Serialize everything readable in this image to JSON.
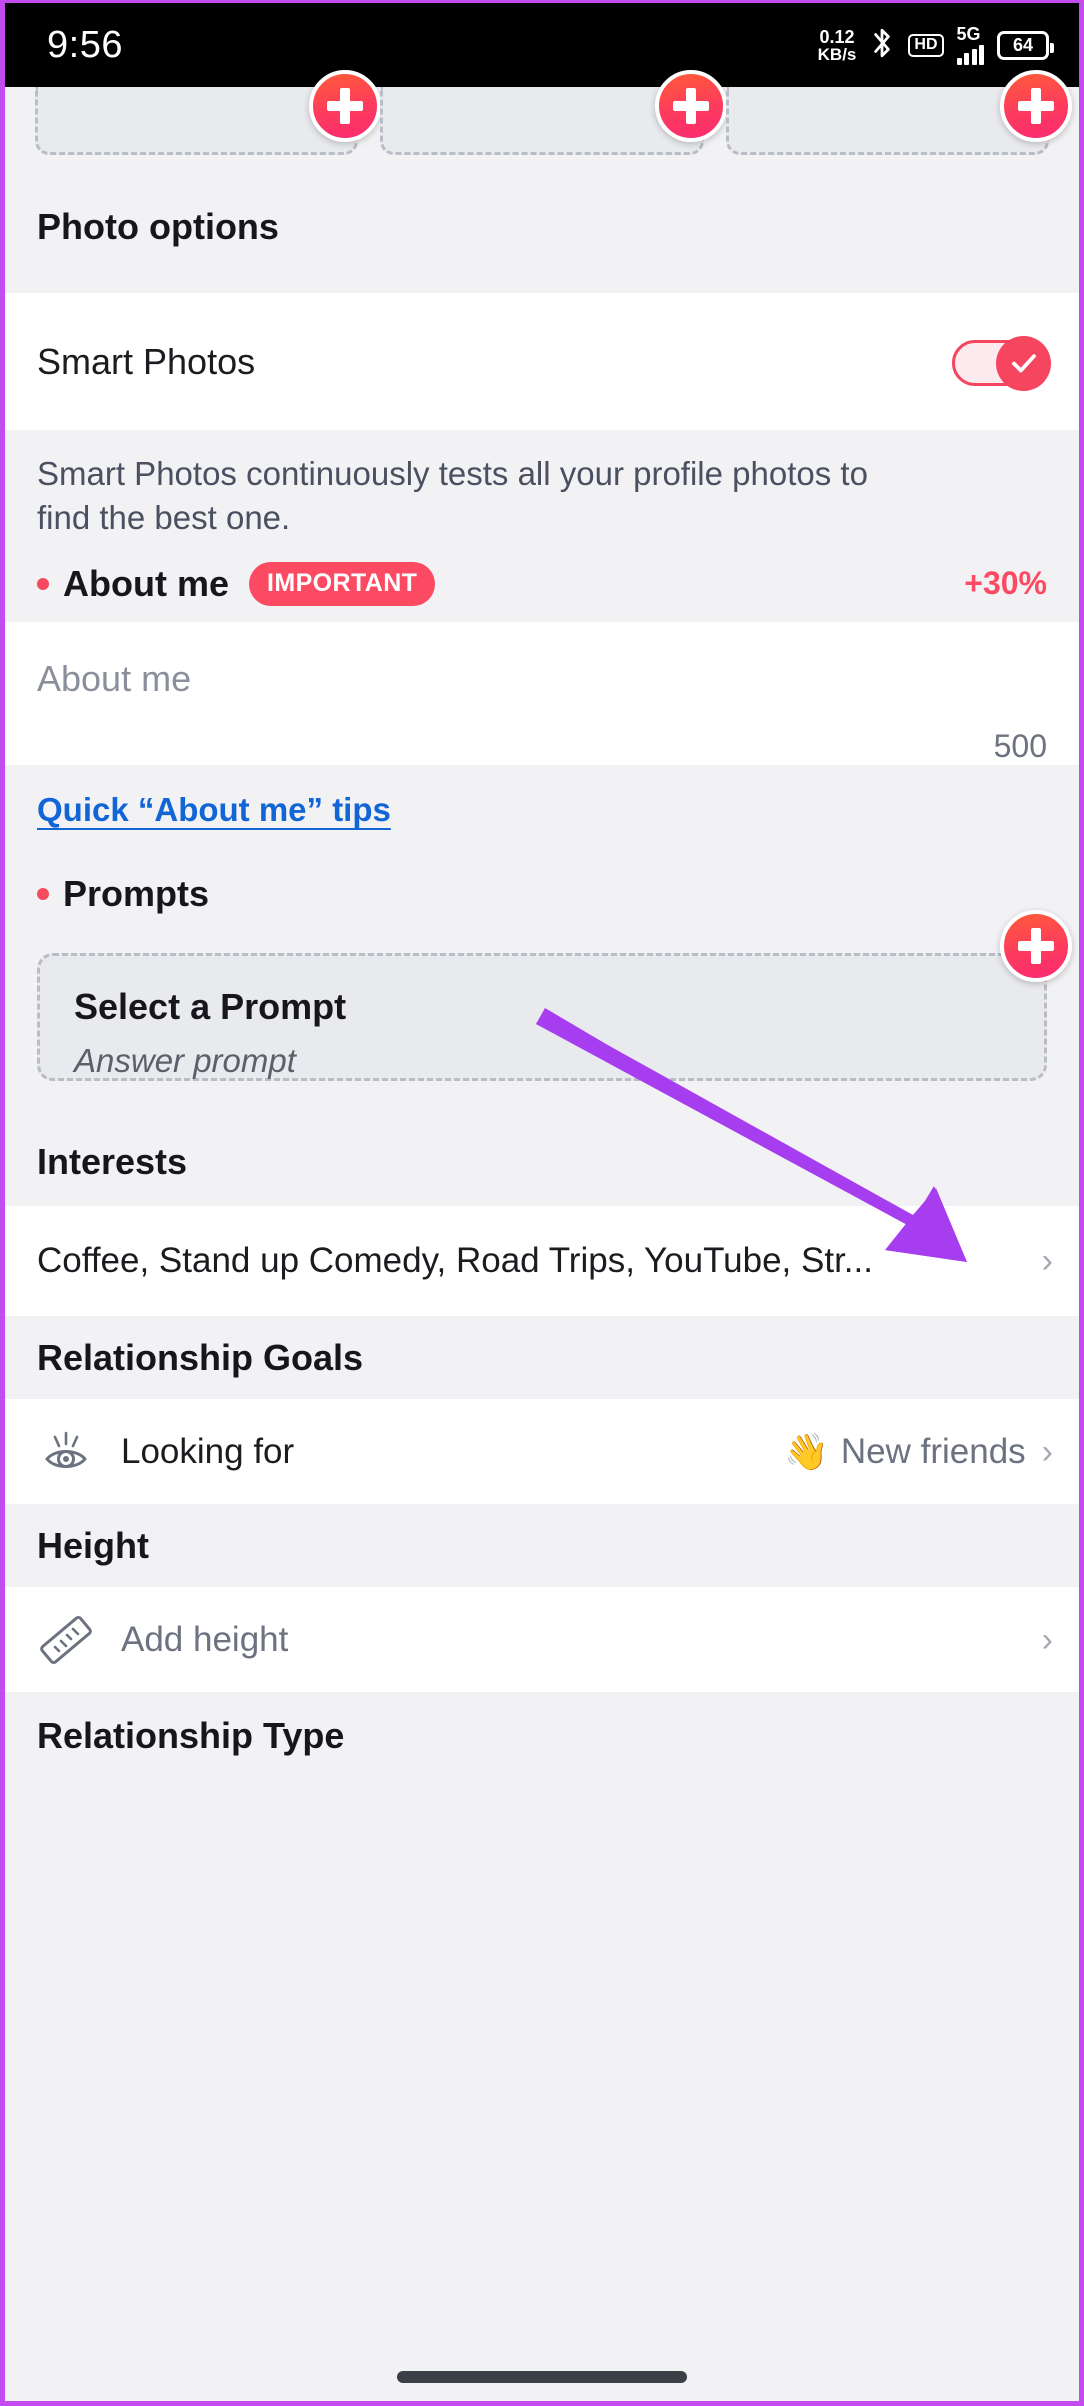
{
  "statusbar": {
    "time": "9:56",
    "net_speed_value": "0.12",
    "net_speed_unit": "KB/s",
    "bluetooth_icon": "bluetooth-icon",
    "hd_label": "HD",
    "network_label": "5G",
    "battery_level": "64"
  },
  "photos": {
    "tiles": [
      {
        "add_label": "+"
      },
      {
        "add_label": "+"
      },
      {
        "add_label": "+"
      }
    ]
  },
  "photo_options": {
    "header": "Photo options",
    "smart_photos_label": "Smart Photos",
    "smart_photos_enabled": "on",
    "description": "Smart Photos continuously tests all your profile photos to find the best one."
  },
  "about_me": {
    "title": "About me",
    "badge": "IMPORTANT",
    "percent": "+30%",
    "placeholder": "About me",
    "counter": "500",
    "tips_link": "Quick “About me” tips"
  },
  "prompts": {
    "title": "Prompts",
    "card_title": "Select a Prompt",
    "card_sub": "Answer prompt",
    "add_label": "+"
  },
  "interests": {
    "header": "Interests",
    "value": "Coffee, Stand up Comedy, Road Trips, YouTube, Str...",
    "chevron": "›"
  },
  "relationship_goals": {
    "header": "Relationship Goals",
    "row_label": "Looking for",
    "row_icon": "eye-icon",
    "value_emoji": "👋",
    "value": "New friends",
    "chevron": "›"
  },
  "height": {
    "header": "Height",
    "row_icon": "ruler-icon",
    "placeholder": "Add height",
    "chevron": "›"
  },
  "relationship_type": {
    "header": "Relationship Type"
  },
  "annotation": {
    "arrow_color": "#a63ef0",
    "arrow_target": "prompts-add-button"
  },
  "colors": {
    "accent_red": "#fb4a62",
    "link_blue": "#1265d4",
    "section_bg": "#f2f2f5",
    "row_bg": "#ffffff"
  }
}
